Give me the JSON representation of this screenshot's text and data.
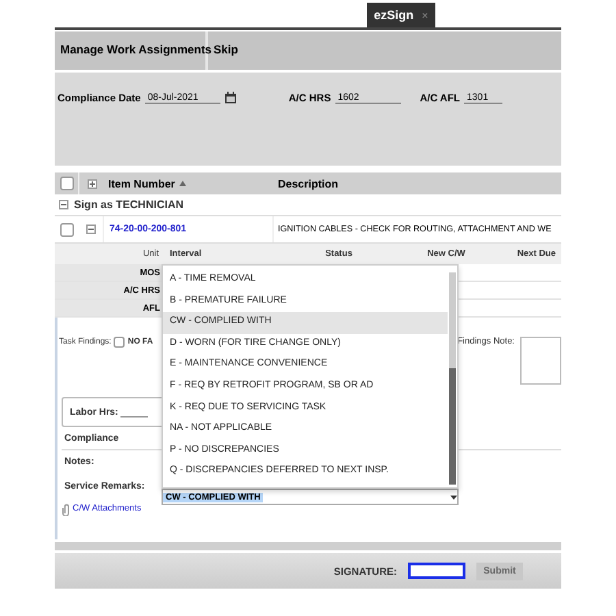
{
  "tab": {
    "label": "ezSign",
    "close": "×"
  },
  "header": {
    "items": [
      "Manage Work Assignments",
      "Skip"
    ]
  },
  "compliance_fields": [
    {
      "kind": "date",
      "label": "Compliance Date",
      "value": "08-Jul-2021"
    },
    {
      "kind": "text",
      "label": "A/C HRS",
      "value": "1602"
    },
    {
      "kind": "text",
      "label": "A/C AFL",
      "value": "1301"
    }
  ],
  "table": {
    "select_all": false,
    "columns": [
      "Item Number",
      "Description"
    ]
  },
  "group": {
    "label": "Sign as TECHNICIAN",
    "expanded": true
  },
  "item": {
    "checked": false,
    "expanded": true,
    "number": "74-20-00-200-801",
    "description": "IGNITION CABLES - CHECK FOR ROUTING, ATTACHMENT AND WE"
  },
  "interval_table": {
    "columns": [
      "Unit",
      "Interval",
      "Status",
      "New C/W",
      "Next Due"
    ],
    "rows": [
      "MOS",
      "A/C HRS",
      "AFL"
    ]
  },
  "task_findings": {
    "label": "Task Findings:",
    "option": {
      "label": "NO FA",
      "checked": false
    },
    "note_label": "Findings Note:"
  },
  "labor_hrs": {
    "label": "Labor Hrs:"
  },
  "compliance_label": "Compliance",
  "notes_label": "Notes:",
  "service_remarks": {
    "label": "Service Remarks:",
    "value": "CW - COMPLIED WITH",
    "open": true,
    "options": [
      {
        "label": "A - TIME REMOVAL",
        "selected": false
      },
      {
        "label": "B - PREMATURE FAILURE",
        "selected": false
      },
      {
        "label": "CW - COMPLIED WITH",
        "selected": true
      },
      {
        "label": "D - WORN (FOR TIRE CHANGE ONLY)",
        "selected": false
      },
      {
        "label": "E - MAINTENANCE CONVENIENCE",
        "selected": false
      },
      {
        "label": "F - REQ BY RETROFIT PROGRAM, SB OR AD",
        "selected": false
      },
      {
        "label": "K - REQ DUE TO SERVICING TASK",
        "selected": false
      },
      {
        "label": "NA - NOT APPLICABLE",
        "selected": false
      },
      {
        "label": "P - NO DISCREPANCIES",
        "selected": false
      },
      {
        "label": "Q - DISCREPANCIES DEFERRED TO NEXT INSP.",
        "selected": false
      }
    ]
  },
  "attachments": {
    "label": "C/W Attachments"
  },
  "signature": {
    "label": "SIGNATURE:",
    "button": "Submit"
  }
}
